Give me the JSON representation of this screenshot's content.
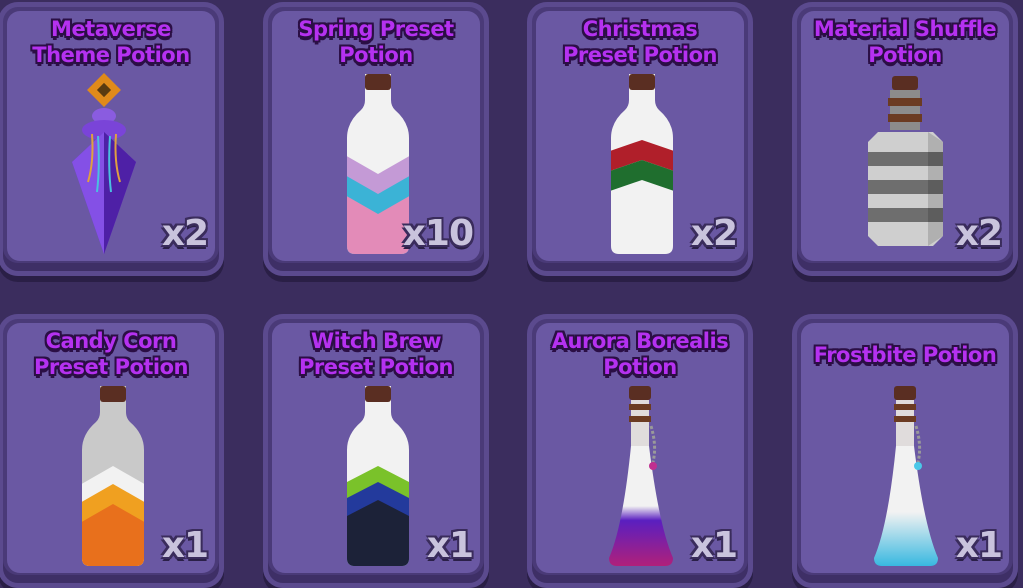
{
  "inventory": {
    "items": [
      {
        "name": "Metaverse\nTheme Potion",
        "quantity": "x2",
        "icon": "metaverse-potion-icon"
      },
      {
        "name": "Spring Preset\nPotion",
        "quantity": "x10",
        "icon": "spring-potion-icon"
      },
      {
        "name": "Christmas\nPreset Potion",
        "quantity": "x2",
        "icon": "christmas-potion-icon"
      },
      {
        "name": "Material Shuffle\nPotion",
        "quantity": "x2",
        "icon": "material-shuffle-potion-icon"
      },
      {
        "name": "Candy Corn\nPreset Potion",
        "quantity": "x1",
        "icon": "candy-corn-potion-icon"
      },
      {
        "name": "Witch Brew\nPreset Potion",
        "quantity": "x1",
        "icon": "witch-brew-potion-icon"
      },
      {
        "name": "Aurora Borealis\nPotion",
        "quantity": "x1",
        "icon": "aurora-borealis-potion-icon"
      },
      {
        "name": "Frostbite Potion",
        "quantity": "x1",
        "icon": "frostbite-potion-icon"
      }
    ]
  },
  "colors": {
    "background": "#3b2d5e",
    "card": "#6a58a3",
    "title": "#b531f0",
    "quantity": "#c9c3dd"
  }
}
